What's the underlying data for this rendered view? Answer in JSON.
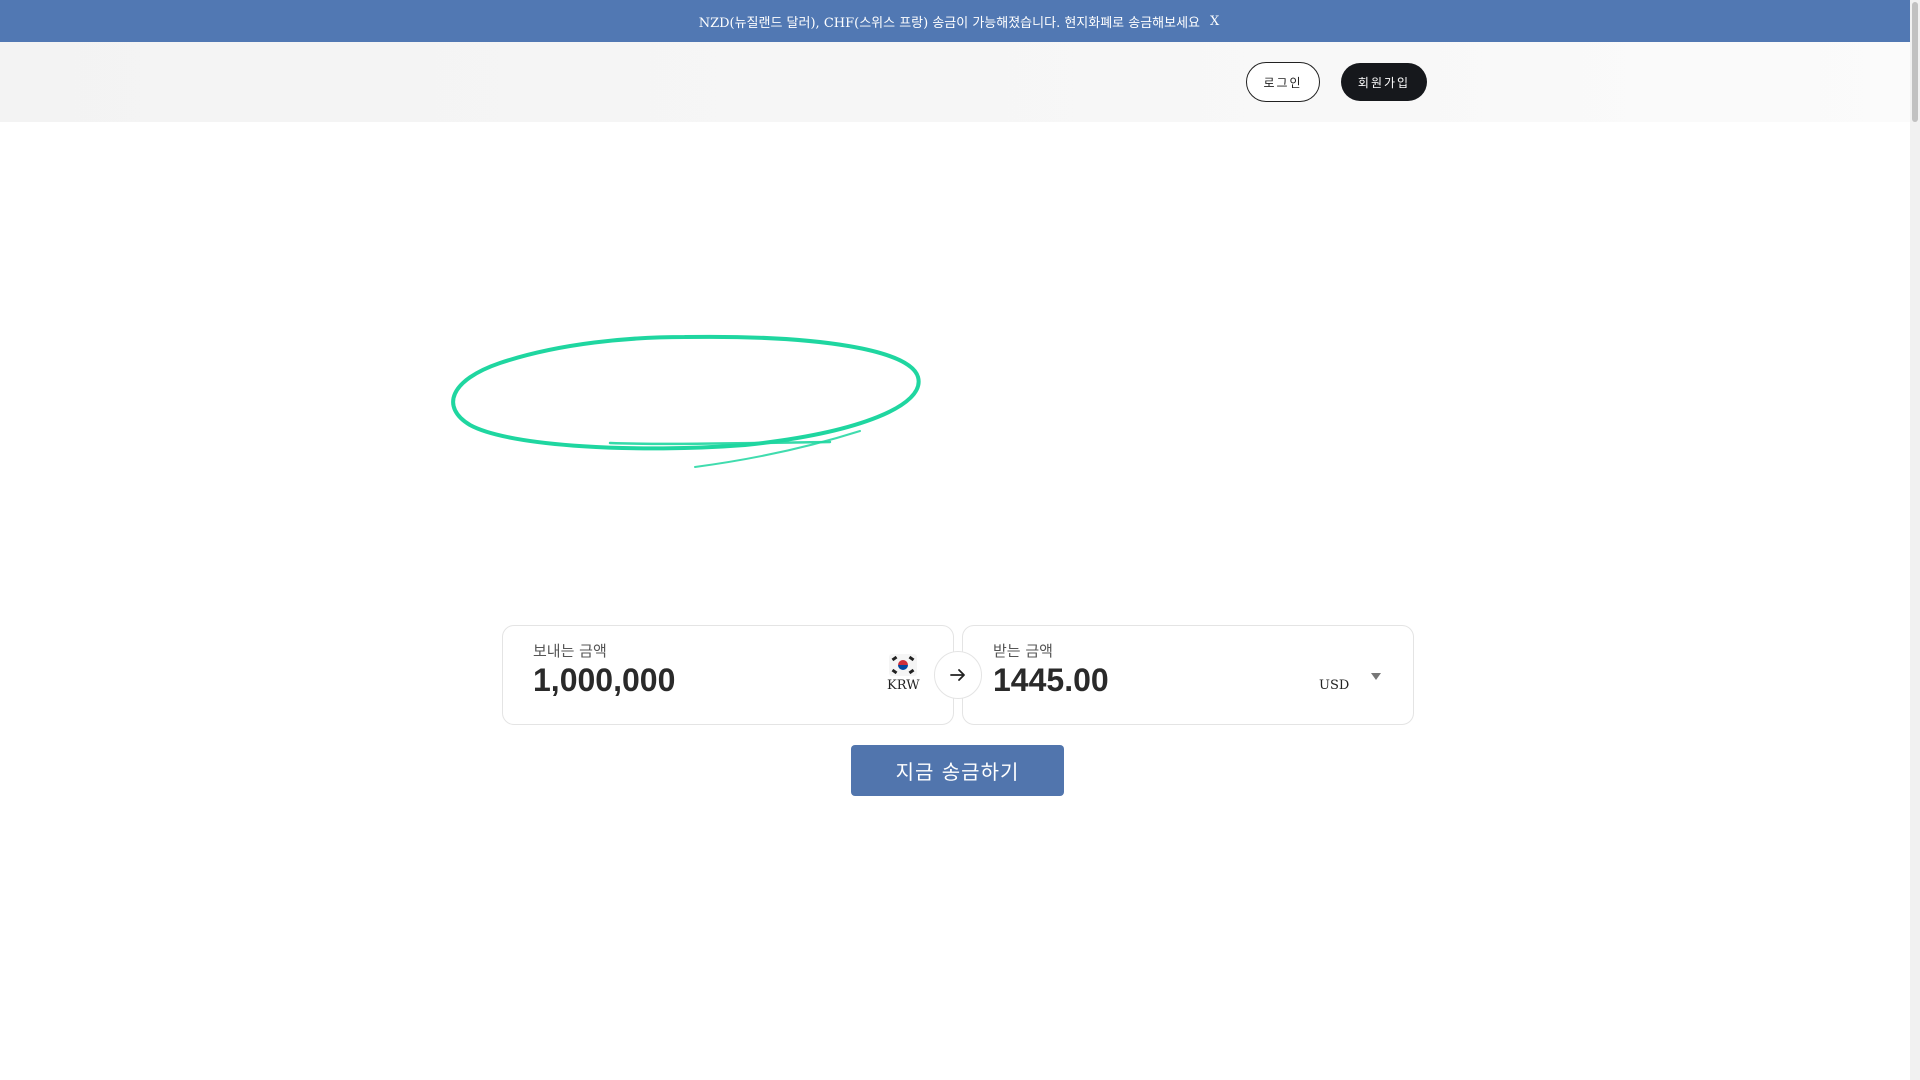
{
  "banner": {
    "message": "NZD(뉴질랜드 달러), CHF(스위스 프랑) 송금이 가능해졌습니다. 현지화폐로 송금해보세요",
    "close_label": "X"
  },
  "header": {
    "login_label": "로그인",
    "signup_label": "회원가입"
  },
  "converter": {
    "send": {
      "label": "보내는 금액",
      "amount": "1,000,000",
      "currency": "KRW",
      "flag": "korea-flag-icon"
    },
    "receive": {
      "label": "받는 금액",
      "amount": "1445.00",
      "currency": "USD"
    },
    "swap_icon": "arrow-right-icon"
  },
  "cta": {
    "label": "지금 송금하기"
  },
  "colors": {
    "banner": "#5178b3",
    "cta": "#5175ad",
    "signup": "#16181c",
    "scribble": "#1fd6a0"
  }
}
